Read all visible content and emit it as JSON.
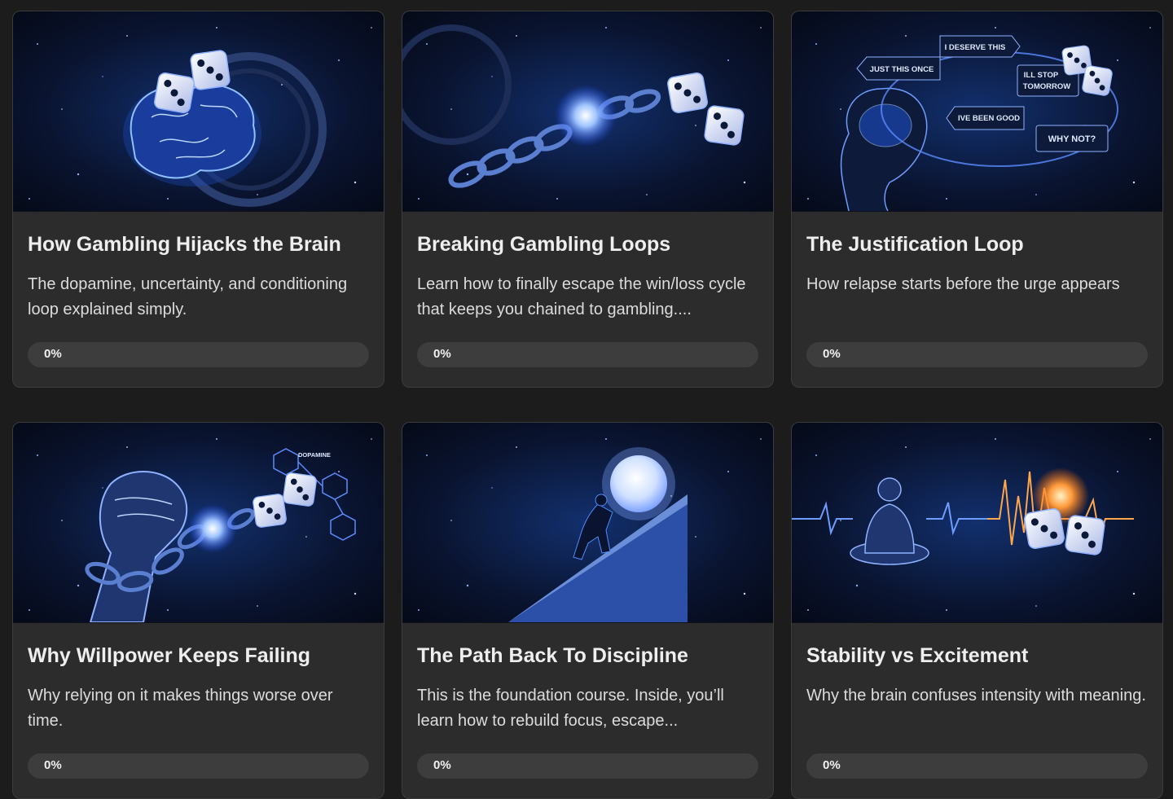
{
  "courses": [
    {
      "title": "How Gambling Hijacks the Brain",
      "description": "The dopamine, uncertainty, and conditioning loop explained simply.",
      "progress_label": "0%",
      "progress": 0
    },
    {
      "title": "Breaking Gambling Loops",
      "description": "Learn how to finally escape the win/loss cycle that keeps you chained to gambling....",
      "progress_label": "0%",
      "progress": 0
    },
    {
      "title": "The Justification Loop",
      "description": "How relapse starts before the urge appears",
      "progress_label": "0%",
      "progress": 0,
      "image_text": {
        "a": "I DESERVE THIS",
        "b": "JUST THIS ONCE",
        "c": "ILL STOP",
        "d": "TOMORROW",
        "e": "IVE BEEN GOOD",
        "f": "WHY NOT?"
      }
    },
    {
      "title": "Why Willpower Keeps Failing",
      "description": "Why relying on it makes things worse over time.",
      "progress_label": "0%",
      "progress": 0,
      "image_text": {
        "a": "DOPAMINE"
      }
    },
    {
      "title": "The Path Back To Discipline",
      "description": "This is the foundation course. Inside, you’ll learn how to rebuild focus, escape...",
      "progress_label": "0%",
      "progress": 0
    },
    {
      "title": "Stability vs Excitement",
      "description": "Why the brain confuses intensity with meaning.",
      "progress_label": "0%",
      "progress": 0
    }
  ],
  "colors": {
    "page_bg": "#1c1c1c",
    "card_bg": "#2c2c2c",
    "accent_glow": "#4f8cff"
  },
  "icons": [
    "brain-dice-illustration",
    "chain-dice-illustration",
    "thought-loop-illustration",
    "fist-chain-illustration",
    "climber-illustration",
    "meditation-illustration"
  ]
}
